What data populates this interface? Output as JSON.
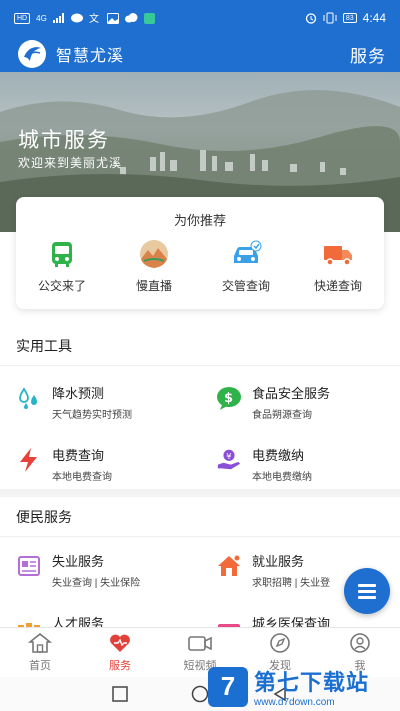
{
  "status_bar": {
    "left_tags": [
      "HD",
      "4G"
    ],
    "time": "4:44",
    "battery": "83"
  },
  "app_bar": {
    "app_name": "智慧尤溪",
    "page_title": "服务"
  },
  "hero": {
    "title": "城市服务",
    "subtitle": "欢迎来到美丽尤溪"
  },
  "recommend": {
    "title": "为你推荐",
    "items": [
      {
        "label": "公交来了",
        "icon": "bus-icon",
        "color": "#2fb24a"
      },
      {
        "label": "慢直播",
        "icon": "live-scenery-icon",
        "color": "#d9834a"
      },
      {
        "label": "交管查询",
        "icon": "car-icon",
        "color": "#3aa0e8"
      },
      {
        "label": "快递查询",
        "icon": "delivery-truck-icon",
        "color": "#f06a3a"
      }
    ]
  },
  "tools_section": {
    "title": "实用工具",
    "items": [
      {
        "title": "降水预测",
        "desc": "天气趋势实时预测",
        "icon": "rain-drops-icon",
        "color": "#27b3c9"
      },
      {
        "title": "食品安全服务",
        "desc": "食品朔源查询",
        "icon": "food-safety-icon",
        "color": "#2fb24a"
      },
      {
        "title": "电费查询",
        "desc": "本地电费查询",
        "icon": "lightning-icon",
        "color": "#e8413a"
      },
      {
        "title": "电费缴纳",
        "desc": "本地电费缴纳",
        "icon": "pay-hand-icon",
        "color": "#8a4fd6"
      }
    ]
  },
  "people_section": {
    "title": "便民服务",
    "items": [
      {
        "title": "失业服务",
        "desc": "失业查询 | 失业保险",
        "icon": "unemployment-icon",
        "color": "#b36fd6"
      },
      {
        "title": "就业服务",
        "desc": "求职招聘 | 失业登",
        "icon": "employment-house-icon",
        "color": "#f06a3a"
      },
      {
        "title": "人才服务",
        "desc": "",
        "icon": "talent-icon",
        "color": "#f0a030"
      },
      {
        "title": "城乡医保查询",
        "desc": "",
        "icon": "medical-insurance-icon",
        "color": "#e84a8a"
      }
    ]
  },
  "tabbar": {
    "tabs": [
      {
        "label": "首页",
        "icon": "home-icon",
        "active": false
      },
      {
        "label": "服务",
        "icon": "heart-icon",
        "active": true
      },
      {
        "label": "短视频",
        "icon": "video-icon",
        "active": false
      },
      {
        "label": "发现",
        "icon": "discover-icon",
        "active": false
      },
      {
        "label": "我",
        "icon": "profile-icon",
        "active": false
      }
    ]
  },
  "watermark": {
    "title": "第七下载站",
    "url": "www.d7down.com",
    "badge": "7"
  },
  "colors": {
    "primary": "#1e6fd0",
    "active_tab": "#e0423a"
  }
}
